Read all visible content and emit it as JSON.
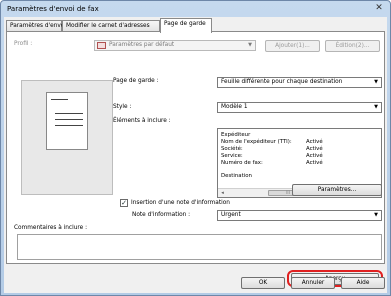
{
  "window": {
    "title": "Paramètres d'envoi de fax",
    "close_glyph": "✕"
  },
  "tabs": [
    {
      "label": "Paramètres d'envoi",
      "active": false
    },
    {
      "label": "Modifier le carnet d'adresses",
      "active": false
    },
    {
      "label": "Page de garde",
      "active": true
    }
  ],
  "profile": {
    "label": "Profil :",
    "value": "Paramètres par défaut",
    "add_button": "Ajouter(1)...",
    "edit_button": "Édition(2)..."
  },
  "cover_page": {
    "label": "Page de garde :",
    "value": "Feuille différente pour chaque destination"
  },
  "style": {
    "label": "Style :",
    "value": "Modèle 1"
  },
  "items": {
    "label": "Éléments à inclure :",
    "rows": [
      {
        "name": "Expéditeur",
        "value": ""
      },
      {
        "name": "Nom de l'expéditeur (TTI):",
        "value": "Activé"
      },
      {
        "name": "Société:",
        "value": "Activé"
      },
      {
        "name": "Service:",
        "value": "Activé"
      },
      {
        "name": "Numéro de fax:",
        "value": "Activé"
      },
      {
        "name": "",
        "value": ""
      },
      {
        "name": "Destination",
        "value": ""
      }
    ],
    "scroll_left": "◂",
    "scroll_mid": "III",
    "scroll_right": "▸"
  },
  "settings_button": "Paramètres...",
  "info_note": {
    "checkbox_label": "Insertion d'une note d'information",
    "checked": true,
    "check_glyph": "✓",
    "note_label": "Note d'information :",
    "note_value": "Urgent"
  },
  "comments": {
    "label": "Commentaires à inclure :"
  },
  "preview_button": "Aperçu",
  "footer": {
    "ok": "OK",
    "cancel": "Annuler",
    "help": "Aide"
  },
  "arrow_glyph": "▼",
  "colors": {
    "highlight": "#e02020",
    "title_bar": "#c5d9ee"
  }
}
